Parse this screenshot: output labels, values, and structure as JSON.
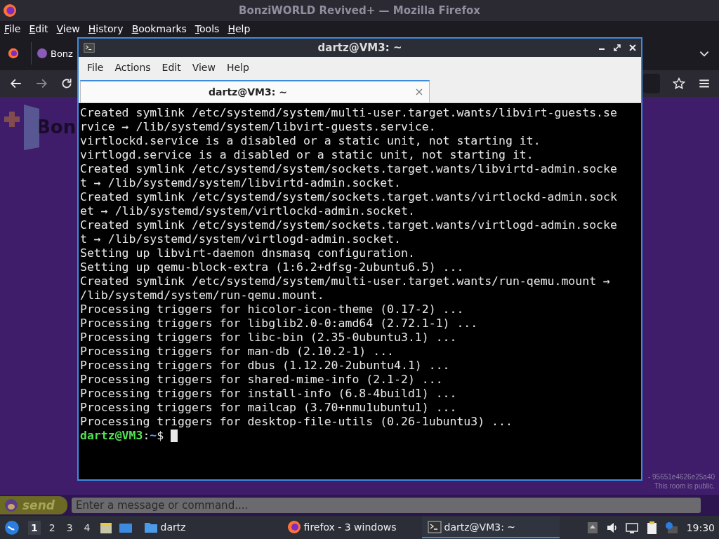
{
  "browser": {
    "title": "BonziWORLD Revived+ — Mozilla Firefox",
    "menu": [
      "File",
      "Edit",
      "View",
      "History",
      "Bookmarks",
      "Tools",
      "Help"
    ],
    "tab_label": "Bonz"
  },
  "page": {
    "logo_text": "Bon",
    "room_id": "- 95651e4626e25a40",
    "room_note": "This room is public.",
    "send_label": "send",
    "message_placeholder": "Enter a message or command...."
  },
  "terminal": {
    "title": "dartz@VM3: ~",
    "menu": [
      "File",
      "Actions",
      "Edit",
      "View",
      "Help"
    ],
    "tabs": [
      {
        "label": "dartz@VM3: ~",
        "selected": true
      }
    ],
    "lines": [
      "Created symlink /etc/systemd/system/multi-user.target.wants/libvirt-guests.se",
      "rvice → /lib/systemd/system/libvirt-guests.service.",
      "virtlockd.service is a disabled or a static unit, not starting it.",
      "virtlogd.service is a disabled or a static unit, not starting it.",
      "Created symlink /etc/systemd/system/sockets.target.wants/libvirtd-admin.socke",
      "t → /lib/systemd/system/libvirtd-admin.socket.",
      "Created symlink /etc/systemd/system/sockets.target.wants/virtlockd-admin.sock",
      "et → /lib/systemd/system/virtlockd-admin.socket.",
      "Created symlink /etc/systemd/system/sockets.target.wants/virtlogd-admin.socke",
      "t → /lib/systemd/system/virtlogd-admin.socket.",
      "Setting up libvirt-daemon dnsmasq configuration.",
      "Setting up qemu-block-extra (1:6.2+dfsg-2ubuntu6.5) ...",
      "Created symlink /etc/systemd/system/multi-user.target.wants/run-qemu.mount →",
      "/lib/systemd/system/run-qemu.mount.",
      "Processing triggers for hicolor-icon-theme (0.17-2) ...",
      "Processing triggers for libglib2.0-0:amd64 (2.72.1-1) ...",
      "Processing triggers for libc-bin (2.35-0ubuntu3.1) ...",
      "Processing triggers for man-db (2.10.2-1) ...",
      "Processing triggers for dbus (1.12.20-2ubuntu4.1) ...",
      "Processing triggers for shared-mime-info (2.1-2) ...",
      "Processing triggers for install-info (6.8-4build1) ...",
      "Processing triggers for mailcap (3.70+nmu1ubuntu1) ...",
      "Processing triggers for desktop-file-utils (0.26-1ubuntu3) ..."
    ],
    "prompt": {
      "user": "dartz@VM3",
      "sep": ":",
      "path": "~",
      "symbol": "$"
    }
  },
  "taskbar": {
    "workspaces": [
      {
        "label": "1",
        "selected": true
      },
      {
        "label": "2",
        "selected": false
      },
      {
        "label": "3",
        "selected": false
      },
      {
        "label": "4",
        "selected": false
      }
    ],
    "tasks": [
      {
        "kind": "folder",
        "label": "dartz",
        "selected": false
      },
      {
        "kind": "firefox",
        "label": "firefox - 3 windows",
        "selected": false
      },
      {
        "kind": "terminal",
        "label": "dartz@VM3: ~",
        "selected": true
      }
    ],
    "clock": "19:30"
  }
}
